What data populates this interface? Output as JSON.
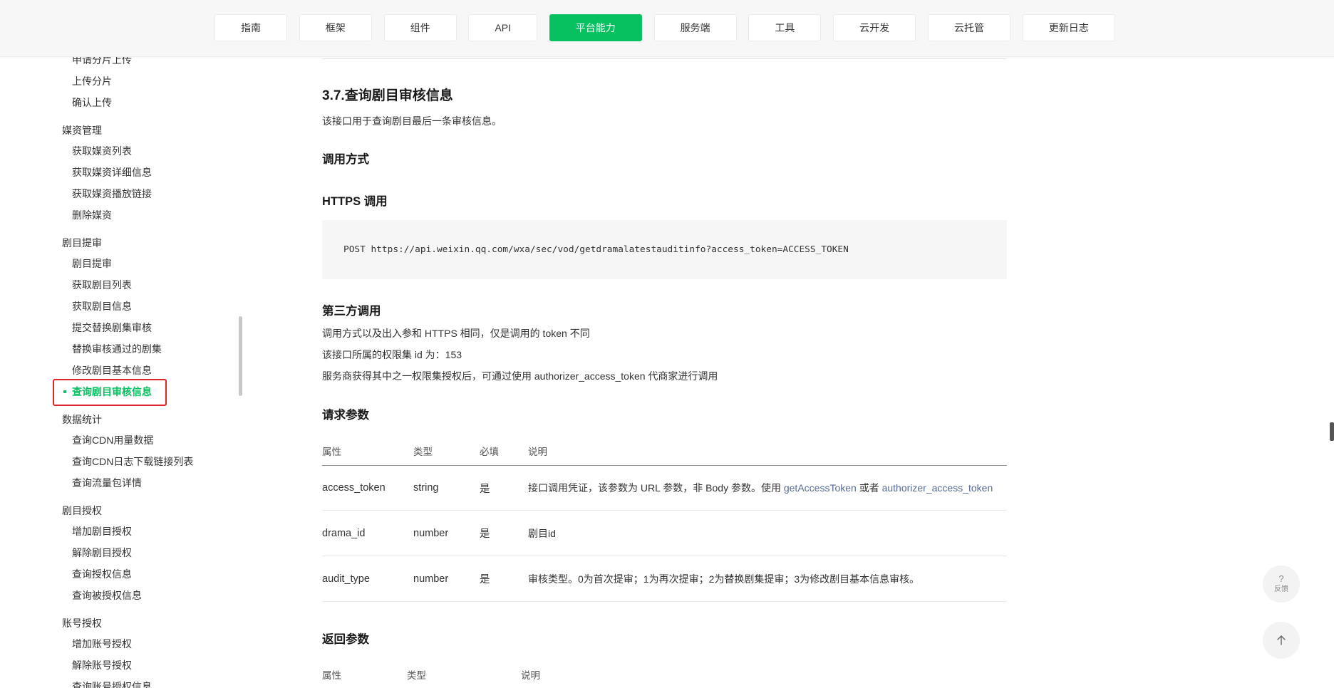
{
  "theme": {
    "brand_green": "#07c160",
    "link_blue": "#576b95",
    "annotation_red": "#e0262a",
    "nav_background": "#f7f7f7",
    "code_background": "#f6f6f6"
  },
  "icons": {
    "feedback": "help-icon",
    "back_to_top": "arrow-up-icon"
  },
  "nav": {
    "tabs": [
      {
        "label": "指南"
      },
      {
        "label": "框架"
      },
      {
        "label": "组件"
      },
      {
        "label": "API"
      },
      {
        "label": "平台能力",
        "active": true
      },
      {
        "label": "服务端"
      },
      {
        "label": "工具"
      },
      {
        "label": "云开发"
      },
      {
        "label": "云托管"
      },
      {
        "label": "更新日志"
      }
    ]
  },
  "sidebar": {
    "groups": [
      {
        "items": [
          {
            "label": "申请分片上传"
          },
          {
            "label": "上传分片"
          },
          {
            "label": "确认上传"
          }
        ]
      },
      {
        "heading": "媒资管理",
        "items": [
          {
            "label": "获取媒资列表"
          },
          {
            "label": "获取媒资详细信息"
          },
          {
            "label": "获取媒资播放链接"
          },
          {
            "label": "删除媒资"
          }
        ]
      },
      {
        "heading": "剧目提审",
        "items": [
          {
            "label": "剧目提审"
          },
          {
            "label": "获取剧目列表"
          },
          {
            "label": "获取剧目信息"
          },
          {
            "label": "提交替换剧集审核"
          },
          {
            "label": "替换审核通过的剧集"
          },
          {
            "label": "修改剧目基本信息"
          },
          {
            "label": "查询剧目审核信息",
            "active": true,
            "highlighted": true
          }
        ]
      },
      {
        "heading": "数据统计",
        "items": [
          {
            "label": "查询CDN用量数据"
          },
          {
            "label": "查询CDN日志下载链接列表"
          },
          {
            "label": "查询流量包详情"
          }
        ]
      },
      {
        "heading": "剧目授权",
        "items": [
          {
            "label": "增加剧目授权"
          },
          {
            "label": "解除剧目授权"
          },
          {
            "label": "查询授权信息"
          },
          {
            "label": "查询被授权信息"
          }
        ]
      },
      {
        "heading": "账号授权",
        "items": [
          {
            "label": "增加账号授权"
          },
          {
            "label": "解除账号授权"
          },
          {
            "label": "查询账号授权信息"
          }
        ]
      }
    ]
  },
  "article": {
    "title": "3.7.查询剧目审核信息",
    "description": "该接口用于查询剧目最后一条审核信息。",
    "call_method_heading": "调用方式",
    "https_heading": "HTTPS 调用",
    "https_code": "POST https://api.weixin.qq.com/wxa/sec/vod/getdramalatestauditinfo?access_token=ACCESS_TOKEN",
    "third_party_heading": "第三方调用",
    "third_party_notes": [
      "调用方式以及出入参和 HTTPS 相同，仅是调用的 token 不同",
      "该接口所属的权限集 id 为：153",
      "服务商获得其中之一权限集授权后，可通过使用 authorizer_access_token 代商家进行调用"
    ],
    "request_params": {
      "heading": "请求参数",
      "columns": [
        "属性",
        "类型",
        "必填",
        "说明"
      ],
      "rows": [
        {
          "name": "access_token",
          "type": "string",
          "required": "是",
          "description_text": "接口调用凭证，该参数为 URL 参数，非 Body 参数。使用",
          "description_link_1": "getAccessToken",
          "description_joiner": "或者",
          "description_link_2": "authorizer_access_token"
        },
        {
          "name": "drama_id",
          "type": "number",
          "required": "是",
          "description_text": "剧目id"
        },
        {
          "name": "audit_type",
          "type": "number",
          "required": "是",
          "description_text": "审核类型。0为首次提审；1为再次提审；2为替换剧集提审；3为修改剧目基本信息审核。"
        }
      ]
    },
    "response_params": {
      "heading": "返回参数",
      "columns": [
        "属性",
        "类型",
        "说明"
      ]
    }
  },
  "floating": {
    "feedback": {
      "symbol": "?",
      "label": "反馈"
    }
  }
}
